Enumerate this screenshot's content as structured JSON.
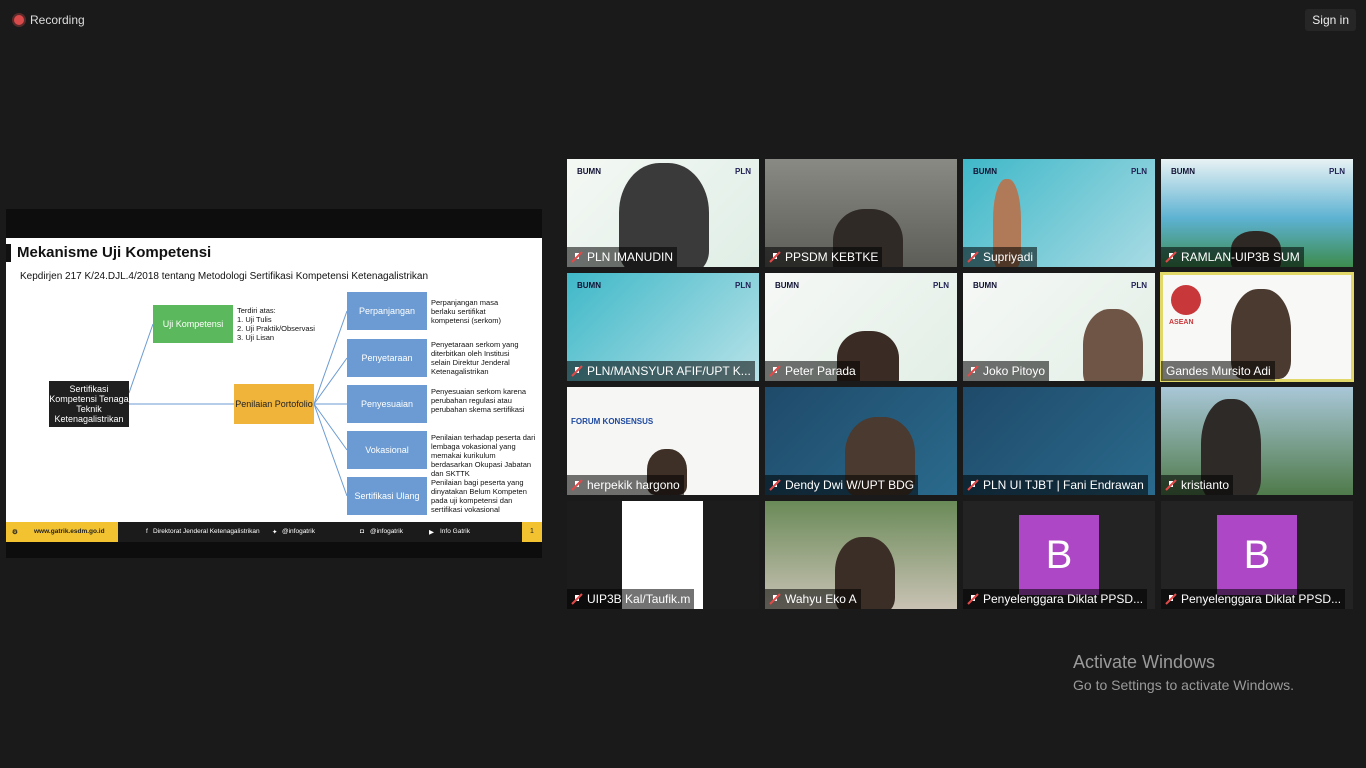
{
  "recording": "Recording",
  "sign_in": "Sign in",
  "slide": {
    "title": "Mekanisme Uji Kompetensi",
    "subtitle": "Kepdirjen 217 K/24.DJL.4/2018 tentang Metodologi Sertifikasi Kompetensi Ketenagalistrikan",
    "root": "Sertifikasi Kompetensi Tenaga Teknik Ketenagalistrikan",
    "uji": "Uji Kompetensi",
    "uji_note": "Terdiri atas:\n1. Uji Tulis\n2. Uji Praktik/Observasi\n3. Uji Lisan",
    "portofolio": "Penilaian Portofolio",
    "items": [
      {
        "label": "Perpanjangan",
        "note": "Perpanjangan masa berlaku sertifikat kompetensi (serkom)"
      },
      {
        "label": "Penyetaraan",
        "note": "Penyetaraan serkom yang diterbitkan oleh Institusi selain Direktur Jenderal Ketenagalistrikan"
      },
      {
        "label": "Penyesuaian",
        "note": "Penyesuaian serkom karena perubahan regulasi atau perubahan skema sertifikasi"
      },
      {
        "label": "Vokasional",
        "note": "Penilaian terhadap peserta dari lembaga vokasional yang memakai kurikulum berdasarkan Okupasi Jabatan dan SKTTK"
      },
      {
        "label": "Sertifikasi Ulang",
        "note": "Penilaian bagi peserta yang dinyatakan Belum Kompeten pada uji kompetensi dan sertifikasi vokasional"
      }
    ],
    "footer": {
      "site": "www.gatrik.esdm.go.id",
      "facebook": "Direktorat Jenderal Ketenagalistrikan",
      "twitter": "@infogatrik",
      "instagram": "@infogatrik",
      "youtube": "Info Gatrik",
      "page": "1"
    }
  },
  "participants": [
    "PLN IMANUDIN",
    "PPSDM KEBTKE",
    "Supriyadi",
    "RAMLAN-UIP3B SUM",
    "PLN/MANSYUR AFIF/UPT K...",
    "Peter Parada",
    "Joko Pitoyo",
    "Gandes Mursito Adi",
    "herpekik hargono",
    "Dendy Dwi W/UPT BDG",
    "PLN UI TJBT | Fani Endrawan",
    "kristianto",
    "UIP3B Kal/Taufik.m",
    "Wahyu Eko A",
    "Penyelenggara Diklat PPSD...",
    "Penyelenggara Diklat PPSD..."
  ],
  "tile_text": {
    "bumn": "BUMN",
    "pln": "PLN",
    "forum": "FORUM KONSENSUS",
    "avatar_letter": "B",
    "asean": "ASEAN"
  },
  "watermark": {
    "title": "Activate Windows",
    "subtitle": "Go to Settings to activate Windows."
  }
}
